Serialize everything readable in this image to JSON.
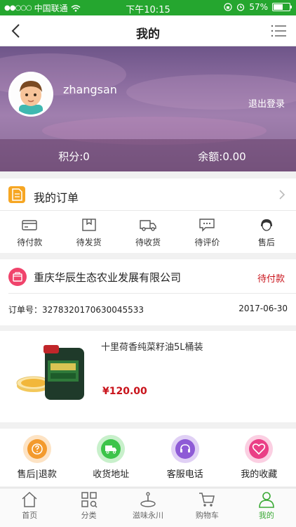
{
  "status_bar": {
    "carrier": "中国联通",
    "time": "下午10:15",
    "battery": "57%"
  },
  "nav": {
    "title": "我的"
  },
  "profile": {
    "username": "zhangsan",
    "logout": "退出登录",
    "points": "积分:0",
    "balance": "余额:0.00"
  },
  "orders": {
    "title": "我的订单",
    "tabs": [
      {
        "label": "待付款",
        "icon": "wallet-icon"
      },
      {
        "label": "待发货",
        "icon": "package-icon"
      },
      {
        "label": "待收货",
        "icon": "truck-icon"
      },
      {
        "label": "待评价",
        "icon": "comment-icon"
      },
      {
        "label": "售后",
        "icon": "headset-icon"
      }
    ]
  },
  "order": {
    "shop": "重庆华辰生态农业发展有限公司",
    "status": "待付款",
    "number": "订单号：3278320170630045533",
    "date": "2017-06-30"
  },
  "product": {
    "name": "十里荷香纯菜籽油5L桶装",
    "price": "¥120.00"
  },
  "services": [
    {
      "label": "售后|退款",
      "icon": "question-icon",
      "color": "#f39a2d",
      "bg": "#fde3c4"
    },
    {
      "label": "收货地址",
      "icon": "truck-icon",
      "color": "#3cc44a",
      "bg": "#c8f0cb"
    },
    {
      "label": "客服电话",
      "icon": "headset-icon",
      "color": "#8e5bd6",
      "bg": "#e0d0f5"
    },
    {
      "label": "我的收藏",
      "icon": "heart-icon",
      "color": "#ea3f86",
      "bg": "#fbcfe2"
    }
  ],
  "tabbar": [
    {
      "label": "首页",
      "icon": "home-icon"
    },
    {
      "label": "分类",
      "icon": "category-icon"
    },
    {
      "label": "滋味永川",
      "icon": "local-icon"
    },
    {
      "label": "购物车",
      "icon": "cart-icon"
    },
    {
      "label": "我的",
      "icon": "user-icon",
      "active": true
    }
  ],
  "colors": {
    "accent_green": "#3aa935",
    "status_green": "#25a62f",
    "price_red": "#c9141c"
  }
}
